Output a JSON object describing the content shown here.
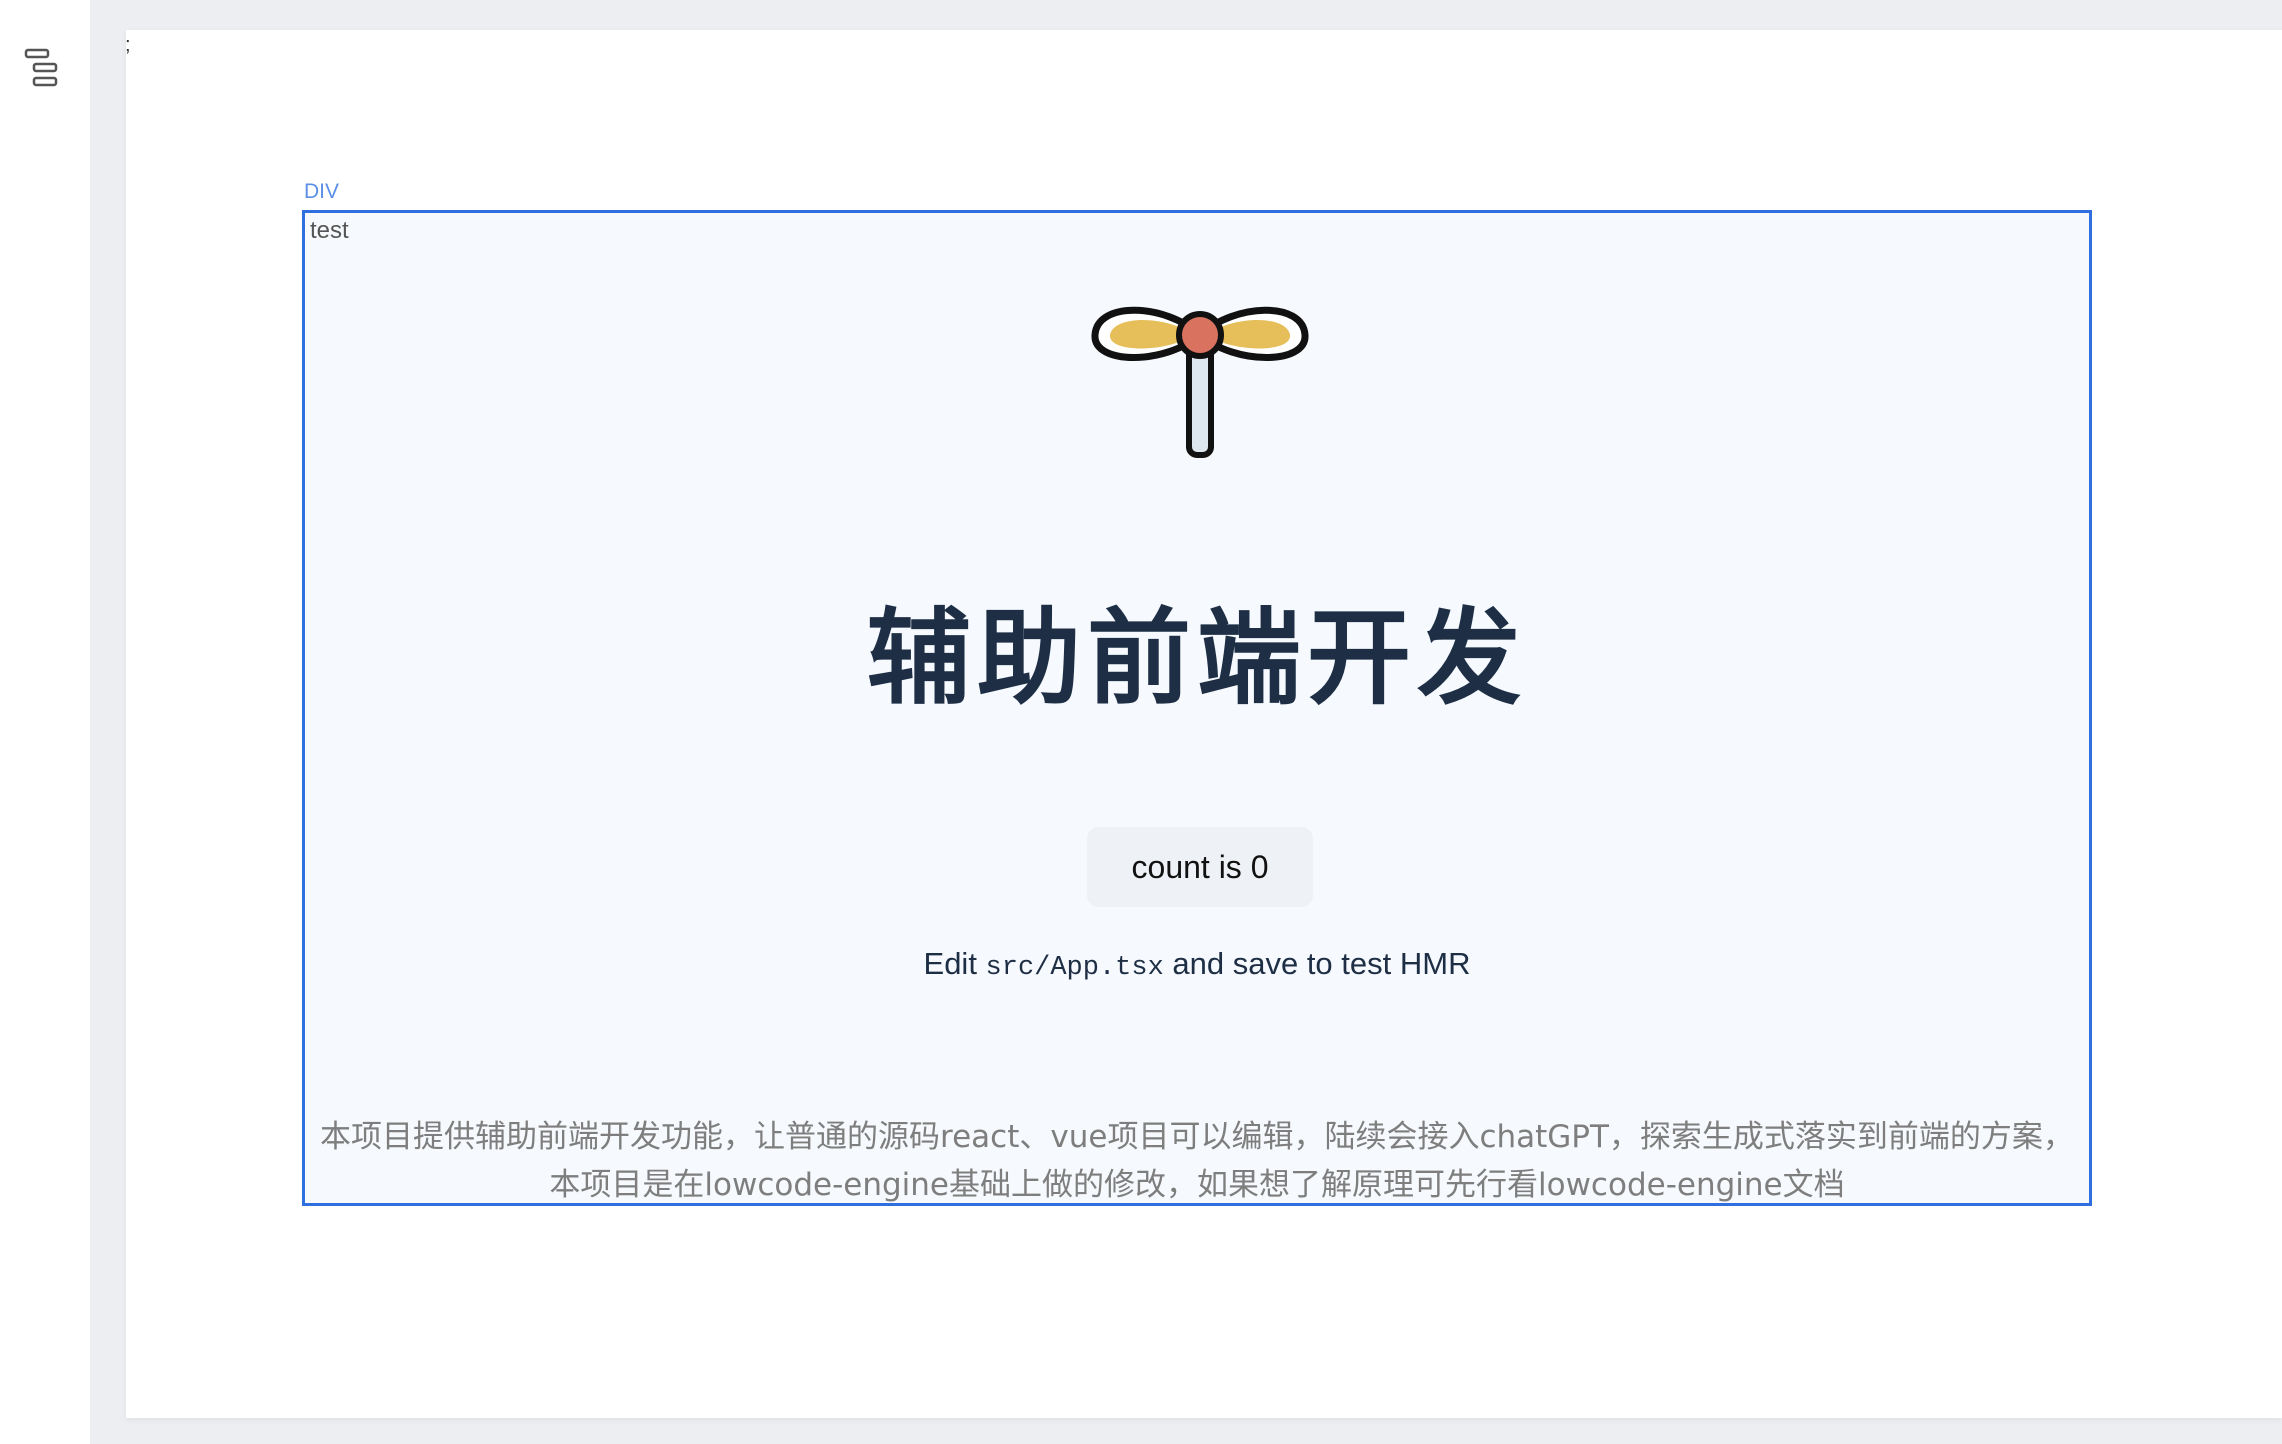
{
  "sidebar": {
    "outline_icon": "outline-tree-icon"
  },
  "canvas": {
    "stray_mark": ";",
    "selection": {
      "tag": "DIV",
      "test_label": "test"
    },
    "logo_icon": "pinwheel-logo-icon",
    "title": "辅助前端开发",
    "count_button": "count is 0",
    "edit_hint": {
      "prefix": "Edit ",
      "code": "src/App.tsx",
      "suffix": " and save to test HMR"
    },
    "description": {
      "line1": "本项目提供辅助前端开发功能，让普通的源码react、vue项目可以编辑，陆续会接入chatGPT，探索生成式落实到前端的方案，",
      "line2": "本项目是在lowcode-engine基础上做的修改，如果想了解原理可先行看lowcode-engine文档"
    }
  },
  "colors": {
    "selection_border": "#2f6fe0",
    "title": "#1e2f45",
    "logo_wing": "#e6bf5a",
    "logo_hub": "#d9735f",
    "logo_stick": "#dde6ef"
  }
}
